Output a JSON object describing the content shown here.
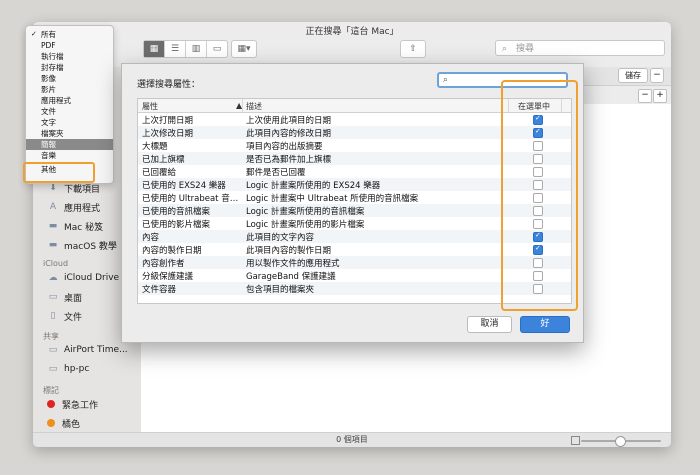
{
  "window": {
    "title": "正在搜尋「這台 Mac」"
  },
  "toolbar": {
    "search_placeholder": "搜尋"
  },
  "scope": {
    "save_label": "儲存",
    "minus": "−"
  },
  "rule": {
    "minus": "−",
    "plus": "+"
  },
  "sidebar": {
    "items_top": [
      {
        "label": "下載項目",
        "icon": "download-icon"
      },
      {
        "label": "應用程式",
        "icon": "applications-icon"
      },
      {
        "label": "Mac 秘笈",
        "icon": "folder-icon"
      },
      {
        "label": "macOS 教學",
        "icon": "folder-icon"
      }
    ],
    "icloud_header": "iCloud",
    "icloud_items": [
      {
        "label": "iCloud Drive",
        "icon": "cloud-icon"
      },
      {
        "label": "桌面",
        "icon": "desktop-icon"
      },
      {
        "label": "文件",
        "icon": "document-icon"
      }
    ],
    "shared_header": "共享",
    "shared_items": [
      {
        "label": "AirPort Time...",
        "icon": "display-icon"
      },
      {
        "label": "hp-pc",
        "icon": "display-icon"
      }
    ],
    "tags_header": "標記",
    "tags": [
      {
        "label": "緊急工作",
        "color": "#e02424"
      },
      {
        "label": "橘色",
        "color": "#f0901a"
      }
    ]
  },
  "kind_menu": {
    "items": [
      "所有",
      "PDF",
      "執行檔",
      "封存檔",
      "影像",
      "影片",
      "應用程式",
      "文件",
      "文字",
      "檔案夾",
      "簡報",
      "音樂",
      "其他"
    ],
    "checked_index": 0,
    "selected_index": 10
  },
  "dialog": {
    "title": "選擇搜尋屬性：",
    "col_attribute": "屬性",
    "col_description": "描述",
    "col_in_menu": "在選單中",
    "rows": [
      {
        "attr": "上次打開日期",
        "desc": "上次使用此項目的日期",
        "checked": true
      },
      {
        "attr": "上次修改日期",
        "desc": "此項目內容的修改日期",
        "checked": true
      },
      {
        "attr": "大標題",
        "desc": "項目內容的出版摘要",
        "checked": false
      },
      {
        "attr": "已加上旗標",
        "desc": "是否已為郵件加上旗標",
        "checked": false
      },
      {
        "attr": "已回覆給",
        "desc": "郵件是否已回覆",
        "checked": false
      },
      {
        "attr": "已使用的 EXS24 樂器",
        "desc": "Logic 計畫案所使用的 EXS24 樂器",
        "checked": false
      },
      {
        "attr": "已使用的 Ultrabeat 音…",
        "desc": "Logic 計畫案中 Ultrabeat 所使用的音訊檔案",
        "checked": false
      },
      {
        "attr": "已使用的音訊檔案",
        "desc": "Logic 計畫案所使用的音訊檔案",
        "checked": false
      },
      {
        "attr": "已使用的影片檔案",
        "desc": "Logic 計畫案所使用的影片檔案",
        "checked": false
      },
      {
        "attr": "內容",
        "desc": "此項目的文字內容",
        "checked": true
      },
      {
        "attr": "內容的製作日期",
        "desc": "此項目內容的製作日期",
        "checked": true
      },
      {
        "attr": "內容創作者",
        "desc": "用以製作文件的應用程式",
        "checked": false
      },
      {
        "attr": "分級保護建議",
        "desc": "GarageBand 保護建議",
        "checked": false
      },
      {
        "attr": "文件容器",
        "desc": "包含項目的檔案夾",
        "checked": false
      }
    ],
    "cancel_label": "取消",
    "ok_label": "好"
  },
  "status": {
    "text": "0 個項目"
  }
}
